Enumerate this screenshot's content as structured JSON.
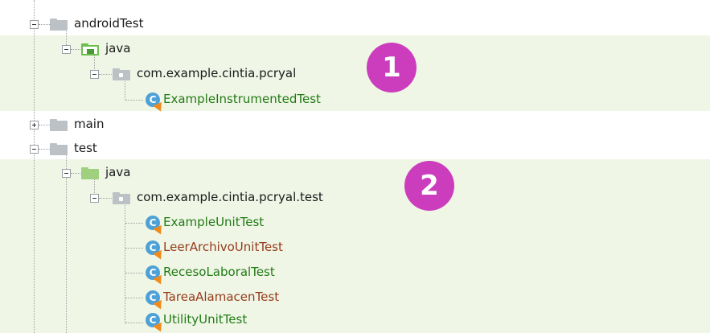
{
  "tree": {
    "nodes": [
      {
        "label": "androidTest",
        "color": "default",
        "expanded": true,
        "icon": "folder-gray-icon"
      },
      {
        "label": "java",
        "color": "default",
        "expanded": true,
        "icon": "test-source-folder-icon"
      },
      {
        "label": "com.example.cintia.pcryal",
        "color": "default",
        "expanded": true,
        "icon": "package-folder-icon"
      },
      {
        "label": "ExampleInstrumentedTest",
        "color": "green",
        "icon": "test-class-icon"
      },
      {
        "label": "main",
        "color": "default",
        "expanded": false,
        "icon": "folder-gray-icon"
      },
      {
        "label": "test",
        "color": "default",
        "expanded": true,
        "icon": "folder-gray-icon"
      },
      {
        "label": "java",
        "color": "default",
        "expanded": true,
        "icon": "folder-green-icon"
      },
      {
        "label": "com.example.cintia.pcryal.test",
        "color": "default",
        "expanded": true,
        "icon": "package-folder-icon"
      },
      {
        "label": "ExampleUnitTest",
        "color": "green",
        "icon": "test-class-icon"
      },
      {
        "label": "LeerArchivoUnitTest",
        "color": "red",
        "icon": "test-class-icon"
      },
      {
        "label": "RecesoLaboralTest",
        "color": "green",
        "icon": "test-class-icon"
      },
      {
        "label": "TareaAlamacenTest",
        "color": "red",
        "icon": "test-class-icon"
      },
      {
        "label": "UtilityUnitTest",
        "color": "green",
        "icon": "test-class-icon"
      }
    ]
  },
  "badges": [
    {
      "label": "1",
      "color": "#cc3dbd"
    },
    {
      "label": "2",
      "color": "#cc3dbd"
    }
  ],
  "colors": {
    "highlight_band": "#eff6e6",
    "test_green_text": "#227a15",
    "test_red_text": "#963a1a",
    "badge": "#cc3dbd"
  }
}
